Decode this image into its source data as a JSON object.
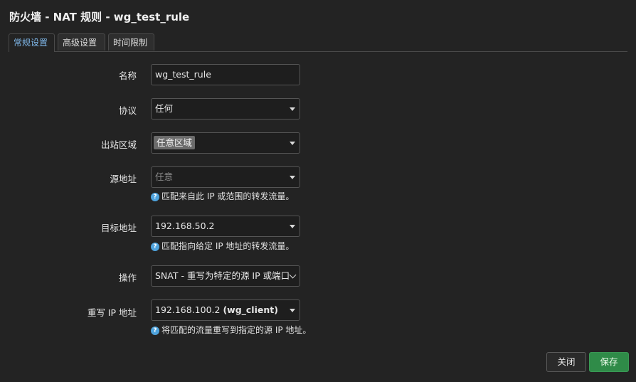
{
  "dialog": {
    "title": "防火墙 - NAT 规则 - wg_test_rule"
  },
  "tabs": [
    {
      "label": "常规设置",
      "active": true
    },
    {
      "label": "高级设置",
      "active": false
    },
    {
      "label": "时间限制",
      "active": false
    }
  ],
  "form": {
    "name": {
      "label": "名称",
      "value": "wg_test_rule"
    },
    "protocol": {
      "label": "协议",
      "value": "任何"
    },
    "outbound_zone": {
      "label": "出站区域",
      "value": "任意区域"
    },
    "source_address": {
      "label": "源地址",
      "value": "任意",
      "hint": "匹配来自此 IP 或范围的转发流量。"
    },
    "dest_address": {
      "label": "目标地址",
      "value": "192.168.50.2",
      "hint": "匹配指向给定 IP 地址的转发流量。"
    },
    "action": {
      "label": "操作",
      "value": "SNAT - 重写为特定的源 IP 或端口"
    },
    "rewrite_ip": {
      "label": "重写 IP 地址",
      "value": "192.168.100.2",
      "value_suffix": "(wg_client)",
      "hint": "将匹配的流量重写到指定的源 IP 地址。"
    }
  },
  "buttons": {
    "close": "关闭",
    "save": "保存"
  },
  "icons": {
    "help": "?"
  },
  "colors": {
    "accent": "#4ea3dd",
    "save": "#2f8b48",
    "active_tab_text": "#7fb7e9"
  }
}
